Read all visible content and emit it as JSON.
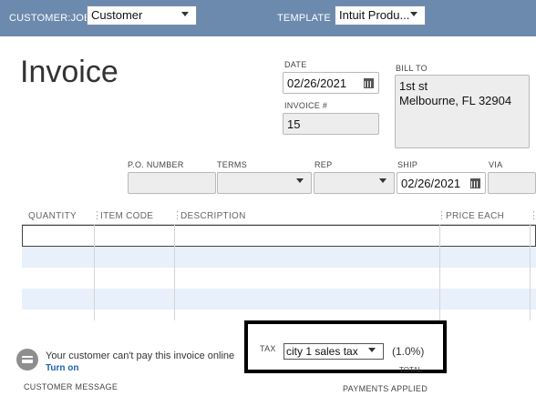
{
  "header": {
    "customer_job_label": "CUSTOMER:JOB",
    "customer_job_value": "Customer",
    "template_label": "TEMPLATE",
    "template_value": "Intuit Produ..."
  },
  "form": {
    "title": "Invoice",
    "date_label": "DATE",
    "date_value": "02/26/2021",
    "invoice_no_label": "INVOICE #",
    "invoice_no_value": "15",
    "bill_to_label": "BILL TO",
    "bill_to_line1": "1st st",
    "bill_to_line2": "Melbourne, FL 32904"
  },
  "details": {
    "po_label": "P.O. NUMBER",
    "terms_label": "TERMS",
    "rep_label": "REP",
    "ship_label": "SHIP",
    "ship_value": "02/26/2021",
    "via_label": "VIA"
  },
  "grid": {
    "columns": [
      "QUANTITY",
      "ITEM CODE",
      "DESCRIPTION",
      "PRICE EACH"
    ],
    "rows": 4
  },
  "footer": {
    "online_pay_message": "Your customer can't pay this invoice online",
    "turn_on_link": "Turn on",
    "customer_message_label": "CUSTOMER MESSAGE",
    "tax_label": "TAX",
    "tax_value": "city 1 sales tax",
    "tax_rate": "(1.0%)",
    "total_label": "TOTAL",
    "payments_applied_label": "PAYMENTS APPLIED"
  },
  "colors": {
    "topbar": "#6b8aae",
    "row_alt": "#e8f0fb",
    "link": "#1a63b8"
  }
}
